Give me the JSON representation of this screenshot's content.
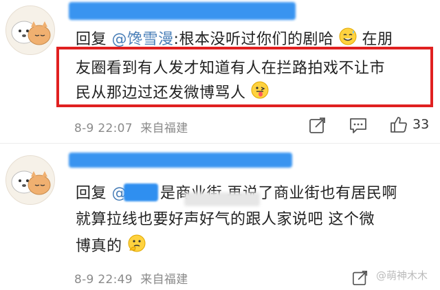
{
  "comments": [
    {
      "reply_prefix": "回复",
      "mention": "@馋雪漫",
      "line1_rest": ":根本没听过你们的剧哈",
      "line1_tail": "在朋",
      "line2": "友圈看到有人发才知道有人在拦路拍戏不让市",
      "line3": "民从那边过还发微博骂人",
      "date": "8-9 22:07",
      "source": "来自福建",
      "like_count": "33"
    },
    {
      "reply_prefix": "回复",
      "mention_start": "@",
      "line1_a": "是",
      "line1_b": "商业街 再说了商业街也有居民啊",
      "line2": "就算拉线也要好声好气的跟人家说吧 这个微",
      "line3": "博真的",
      "date": "8-9 22:49",
      "source": "来自福建"
    }
  ],
  "watermark": "@萌神木木",
  "colors": {
    "highlight": "#e02020",
    "mention": "#4a7fb8",
    "redact": "#2f8ff0"
  },
  "icons": [
    "share-icon",
    "comment-icon",
    "like-icon",
    "sweat-smile-emoji",
    "tongue-emoji",
    "thinking-emoji"
  ]
}
